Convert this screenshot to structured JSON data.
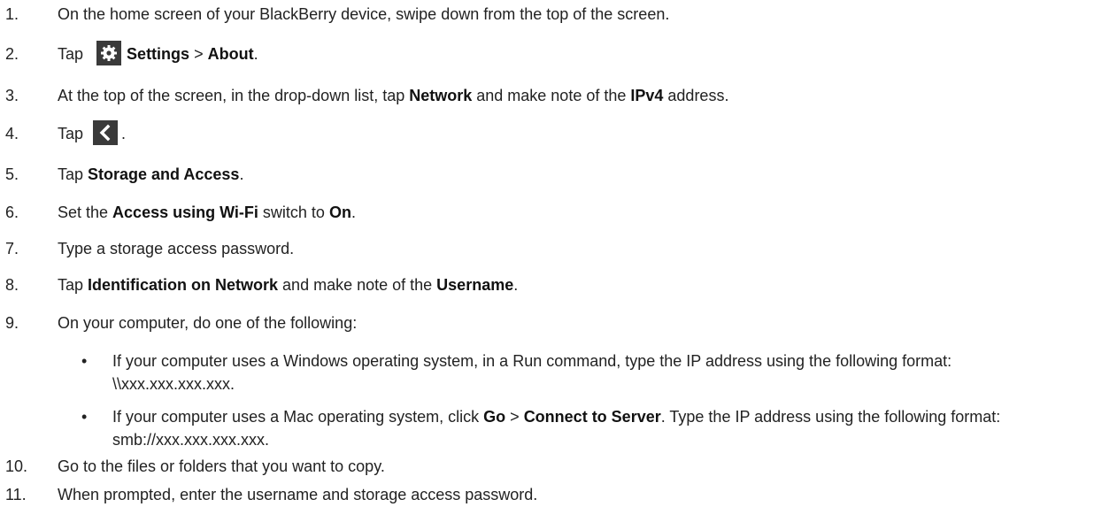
{
  "steps": [
    {
      "num": "1.",
      "text": "On the home screen of your BlackBerry device, swipe down from the top of the screen."
    },
    {
      "num": "2.",
      "tap": "Tap",
      "settings": "Settings",
      "sep": " > ",
      "about": "About",
      "end": "."
    },
    {
      "num": "3.",
      "a": "At the top of the screen, in the drop-down list, tap ",
      "network": "Network",
      "b": " and make note of the ",
      "ipv4": "IPv4",
      "c": " address."
    },
    {
      "num": "4.",
      "tap": "Tap",
      "end": "."
    },
    {
      "num": "5.",
      "a": "Tap ",
      "bold": "Storage and Access",
      "end": "."
    },
    {
      "num": "6.",
      "a": "Set the ",
      "bold1": "Access using Wi-Fi",
      "b": " switch to ",
      "bold2": "On",
      "end": "."
    },
    {
      "num": "7.",
      "text": "Type a storage access password."
    },
    {
      "num": "8.",
      "a": "Tap ",
      "bold1": "Identification on Network",
      "b": " and make note of the ",
      "bold2": "Username",
      "end": "."
    },
    {
      "num": "9.",
      "text": "On your computer, do one of the following:"
    },
    {
      "num": "10.",
      "text": "Go to the files or folders that you want to copy."
    },
    {
      "num": "11.",
      "text": "When prompted, enter the username and storage access password."
    }
  ],
  "bullets": [
    {
      "marker": "•",
      "text": "If your computer uses a Windows operating system, in a Run command, type the IP address using the following format: \\\\xxx.xxx.xxx.xxx."
    },
    {
      "marker": "•",
      "a": "If your computer uses a Mac operating system, click ",
      "go": "Go",
      "sep": " > ",
      "connect": "Connect to Server",
      "b": ". Type the IP address using the following format: smb://xxx.xxx.xxx.xxx."
    }
  ],
  "icons": {
    "settings": "gear-icon",
    "back": "chevron-left-icon"
  }
}
